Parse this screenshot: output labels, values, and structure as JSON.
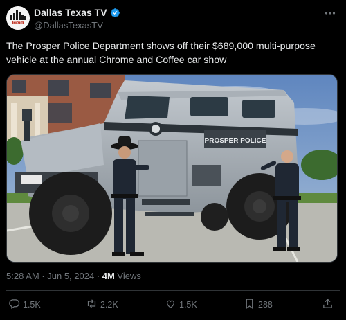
{
  "author": {
    "display_name": "Dallas Texas TV",
    "handle": "@DallasTexasTV",
    "avatar_text": "DTX TV"
  },
  "tweet": {
    "text": "The Prosper Police Department shows off their $689,000 multi-purpose vehicle at the annual Chrome and Coffee car show"
  },
  "media": {
    "vehicle_text": "PROSPER POLICE"
  },
  "meta": {
    "timestamp": "5:28 AM · Jun 5, 2024 · ",
    "views_count": "4M",
    "views_label": " Views"
  },
  "actions": {
    "replies": "1.5K",
    "reposts": "2.2K",
    "likes": "1.5K",
    "bookmarks": "288"
  },
  "icons": [
    "verified-badge-icon",
    "more-icon",
    "reply-icon",
    "repost-icon",
    "like-icon",
    "bookmark-icon",
    "share-icon"
  ],
  "colors": {
    "background": "#000000",
    "text": "#e7e9ea",
    "secondary": "#71767b",
    "verified": "#1d9bf0"
  }
}
